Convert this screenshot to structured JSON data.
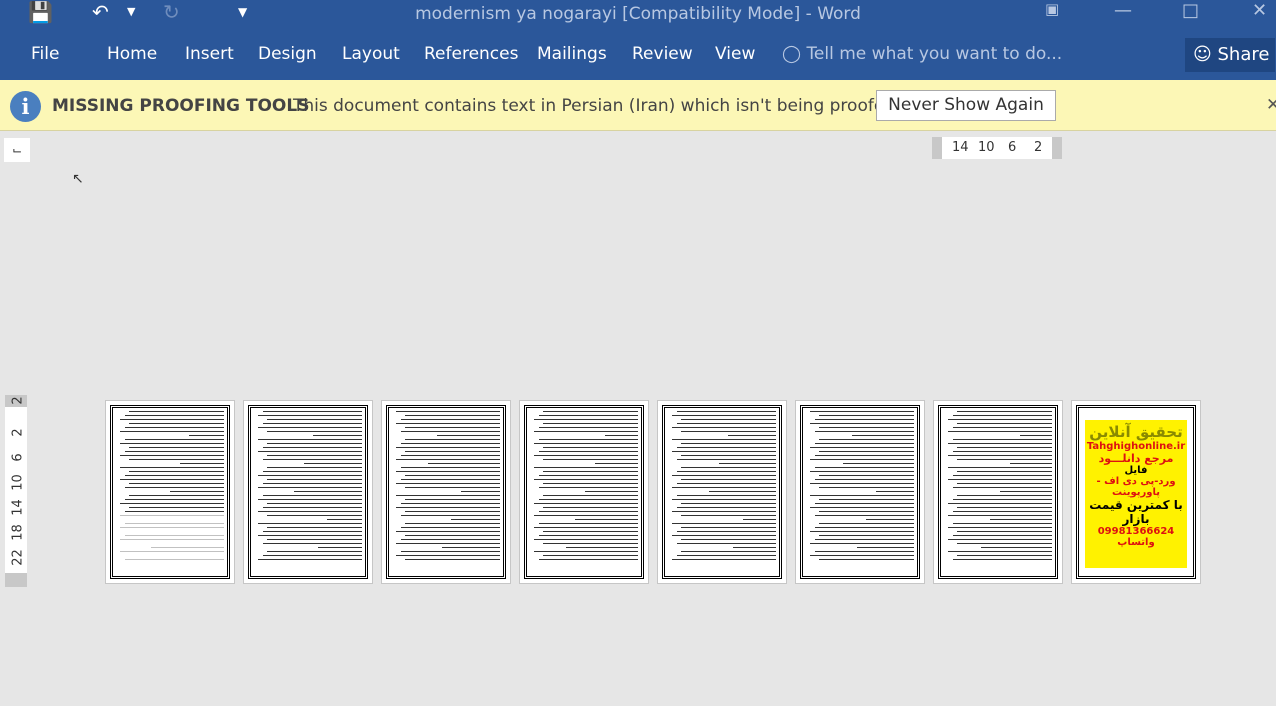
{
  "window": {
    "title": "modernism ya nogarayi [Compatibility Mode] - Word"
  },
  "ribbon": {
    "tabs": [
      "File",
      "Home",
      "Insert",
      "Design",
      "Layout",
      "References",
      "Mailings",
      "Review",
      "View"
    ],
    "tell_me": "Tell me what you want to do...",
    "share": "Share"
  },
  "message_bar": {
    "title": "MISSING PROOFING TOOLS",
    "text": "This document contains text in Persian (Iran) which isn't being proofed.",
    "button": "Never Show Again"
  },
  "rulers": {
    "horizontal": [
      "14",
      "10",
      "6",
      "2"
    ],
    "vertical": [
      "2",
      "2",
      "6",
      "10",
      "14",
      "18",
      "22"
    ]
  },
  "pages": {
    "count": 8,
    "ad": {
      "line1": "تحقیق آنلاین",
      "site": "Tahghighonline.ir",
      "line2": "مرجع دانلـــود",
      "line3": "فایل",
      "line4": "ورد-پی دی اف - پاورپوینت",
      "line5": "با کمترین قیمت بازار",
      "phone": "09981366624",
      "line6": "واتساپ"
    }
  },
  "colors": {
    "titlebar": "#2b579a",
    "message_bar": "#fcf7b6",
    "ad_background": "#fff200"
  }
}
